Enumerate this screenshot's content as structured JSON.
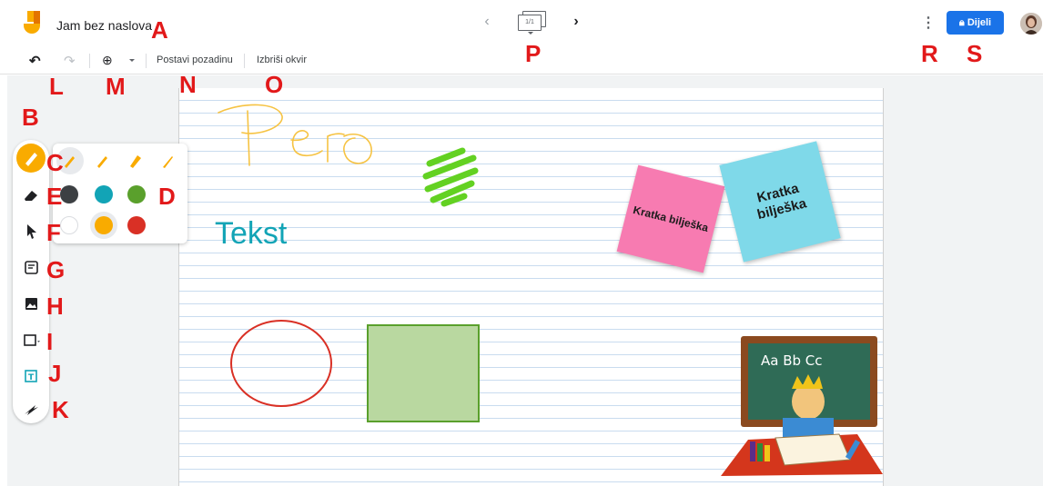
{
  "header": {
    "title": "Jam bez naslova",
    "frame_counter": "1/1",
    "share_label": "Dijeli",
    "prev_icon": "chevron-left-icon",
    "next_icon": "chevron-right-icon",
    "more_icon": "more-vert-icon",
    "share_icon": "lock-icon"
  },
  "toolbar": {
    "undo_icon": "undo-icon",
    "redo_icon": "redo-icon",
    "zoom_icon": "zoom-icon",
    "set_background_label": "Postavi pozadinu",
    "clear_frame_label": "Izbriši okvir"
  },
  "tools": [
    {
      "name": "pen",
      "icon": "pen-icon",
      "active": true
    },
    {
      "name": "eraser",
      "icon": "eraser-icon"
    },
    {
      "name": "select",
      "icon": "pointer-icon"
    },
    {
      "name": "sticky-note",
      "icon": "sticky-note-icon"
    },
    {
      "name": "image",
      "icon": "image-icon"
    },
    {
      "name": "shape",
      "icon": "shape-icon"
    },
    {
      "name": "text-box",
      "icon": "text-box-icon"
    },
    {
      "name": "laser",
      "icon": "laser-icon"
    }
  ],
  "pen_popup": {
    "pen_types": [
      "pen",
      "marker",
      "highlighter",
      "brush"
    ],
    "colors": [
      "#3c4043",
      "#12a4b6",
      "#5aa02c",
      "#ffffff",
      "#f9ab00",
      "#d93025"
    ],
    "selected_color": "#f9ab00"
  },
  "canvas": {
    "handwriting": "Pero",
    "text_label": "Tekst",
    "sticky_pink": "Kratka bilješka",
    "sticky_blue": "Kratka bilješka"
  },
  "annotations": {
    "A": "A",
    "B": "B",
    "C": "C",
    "D": "D",
    "E": "E",
    "F": "F",
    "G": "G",
    "H": "H",
    "I": "I",
    "J": "J",
    "K": "K",
    "L": "L",
    "M": "M",
    "N": "N",
    "O": "O",
    "P": "P",
    "R": "R",
    "S": "S"
  }
}
